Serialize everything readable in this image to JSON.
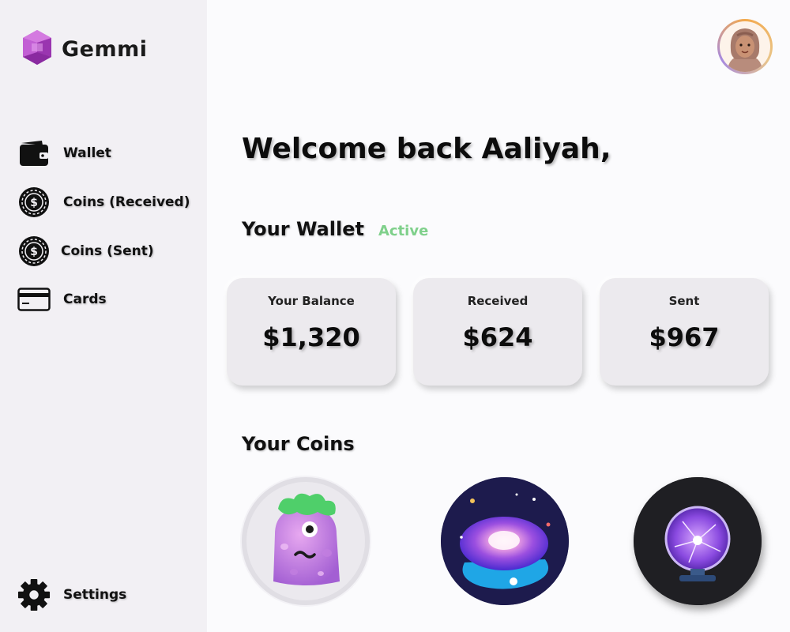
{
  "brand": {
    "name": "Gemmi",
    "accent": "#b44fc6"
  },
  "nav": {
    "items": [
      {
        "label": "Wallet",
        "icon": "wallet-icon"
      },
      {
        "label": "Coins (Received)",
        "icon": "dollar-coin-icon"
      },
      {
        "label": "Coins (Sent)",
        "icon": "dollar-coin-icon"
      },
      {
        "label": "Cards",
        "icon": "credit-card-icon"
      }
    ],
    "settings": {
      "label": "Settings",
      "icon": "gear-icon"
    }
  },
  "header": {
    "avatar": "user-avatar"
  },
  "main": {
    "welcome": "Welcome back Aaliyah,",
    "wallet": {
      "title": "Your Wallet",
      "status": "Active",
      "status_color": "#7fd08b",
      "cards": [
        {
          "label": "Your Balance",
          "value": "$1,320"
        },
        {
          "label": "Received",
          "value": "$624"
        },
        {
          "label": "Sent",
          "value": "$967"
        }
      ]
    },
    "coins": {
      "title": "Your Coins",
      "items": [
        {
          "icon": "purple-monster-coin-icon"
        },
        {
          "icon": "galaxy-coin-icon"
        },
        {
          "icon": "plasma-ball-coin-icon"
        }
      ]
    }
  }
}
